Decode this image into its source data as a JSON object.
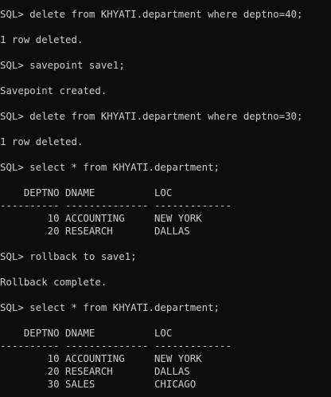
{
  "terminal": {
    "lines": [
      "SQL> delete from KHYATI.department where deptno=40;",
      "",
      "1 row deleted.",
      "",
      "SQL> savepoint save1;",
      "",
      "Savepoint created.",
      "",
      "SQL> delete from KHYATI.department where deptno=30;",
      "",
      "1 row deleted.",
      "",
      "SQL> select * from KHYATI.department;",
      "",
      "    DEPTNO DNAME          LOC",
      "---------- -------------- -------------",
      "        10 ACCOUNTING     NEW YORK",
      "        20 RESEARCH       DALLAS",
      "",
      "SQL> rollback to save1;",
      "",
      "Rollback complete.",
      "",
      "SQL> select * from KHYATI.department;",
      "",
      "    DEPTNO DNAME          LOC",
      "---------- -------------- -------------",
      "        10 ACCOUNTING     NEW YORK",
      "        20 RESEARCH       DALLAS",
      "        30 SALES          CHICAGO"
    ]
  },
  "colors": {
    "background": "#0c0c0c",
    "foreground": "#cccccc"
  }
}
